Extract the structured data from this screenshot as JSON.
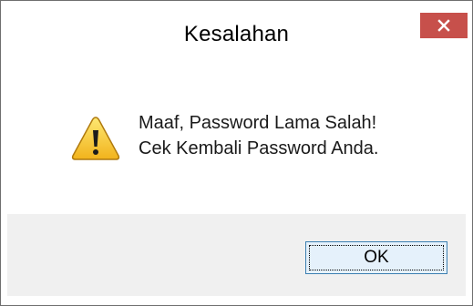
{
  "window": {
    "title": "Kesalahan",
    "close_icon": "close-icon",
    "close_color": "#c7504b"
  },
  "message": {
    "icon": "warning-icon",
    "line1": "Maaf, Password Lama Salah!",
    "line2": "Cek Kembali Password Anda."
  },
  "buttons": {
    "ok_label": "OK"
  }
}
